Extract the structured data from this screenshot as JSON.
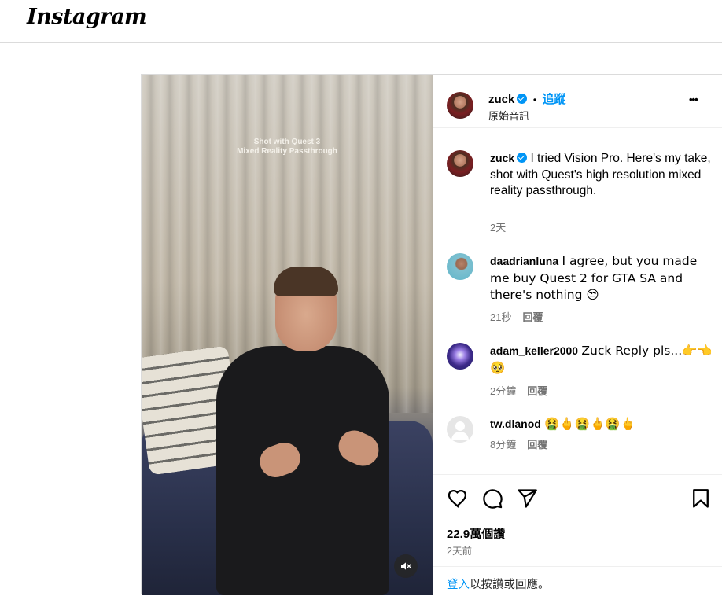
{
  "app": {
    "logo_text": "Instagram"
  },
  "media": {
    "caption_line1": "Shot with Quest 3",
    "caption_line2": "Mixed Reality Passthrough",
    "mute_icon": "speaker-muted-icon"
  },
  "header": {
    "username": "zuck",
    "separator": "•",
    "follow_label": "追蹤",
    "audio_label": "原始音訊",
    "more_label": "•••"
  },
  "caption": {
    "username": "zuck",
    "text": "I tried Vision Pro. Here's my take, shot with Quest's high resolution mixed reality passthrough.",
    "time": "2天"
  },
  "comments": [
    {
      "username": "daadrianluna",
      "text": "I agree, but you made me buy Quest 2 for GTA SA and there's nothing 😒",
      "time": "21秒",
      "reply": "回覆"
    },
    {
      "username": "adam_keller2000",
      "text": "Zuck Reply pls...👉👈🥺",
      "time": "2分鐘",
      "reply": "回覆"
    },
    {
      "username": "tw.dlanod",
      "text": "🤮🖕🤮🖕🤮🖕",
      "time": "8分鐘",
      "reply": "回覆"
    }
  ],
  "actions": {
    "likes": "22.9萬個讚",
    "time_ago": "2天前",
    "login_link": "登入",
    "login_rest": "以按讚或回應。"
  },
  "colors": {
    "accent": "#0095f6",
    "muted": "#737373",
    "border": "#dbdbdb"
  }
}
